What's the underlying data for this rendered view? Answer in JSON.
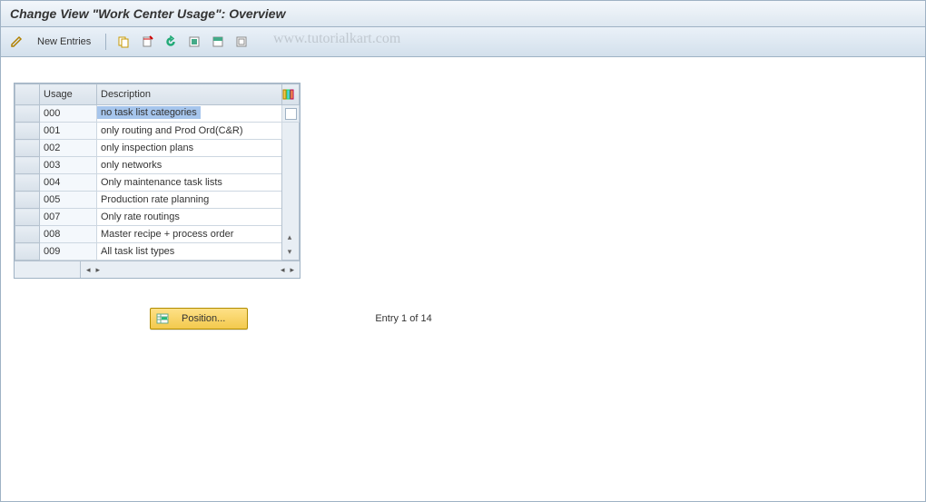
{
  "title": "Change View \"Work Center Usage\": Overview",
  "toolbar": {
    "new_entries": "New Entries"
  },
  "watermark": "www.tutorialkart.com",
  "grid": {
    "headers": {
      "usage": "Usage",
      "description": "Description"
    },
    "rows": [
      {
        "usage": "000",
        "description": "no task list categories",
        "selected": true
      },
      {
        "usage": "001",
        "description": "only routing and Prod Ord(C&R)",
        "selected": false
      },
      {
        "usage": "002",
        "description": "only inspection plans",
        "selected": false
      },
      {
        "usage": "003",
        "description": "only networks",
        "selected": false
      },
      {
        "usage": "004",
        "description": "Only maintenance task lists",
        "selected": false
      },
      {
        "usage": "005",
        "description": "Production rate planning",
        "selected": false
      },
      {
        "usage": "007",
        "description": "Only rate routings",
        "selected": false
      },
      {
        "usage": "008",
        "description": "Master recipe + process order",
        "selected": false
      },
      {
        "usage": "009",
        "description": "All task list types",
        "selected": false
      }
    ]
  },
  "position_button": "Position...",
  "entry_label": "Entry 1 of 14"
}
